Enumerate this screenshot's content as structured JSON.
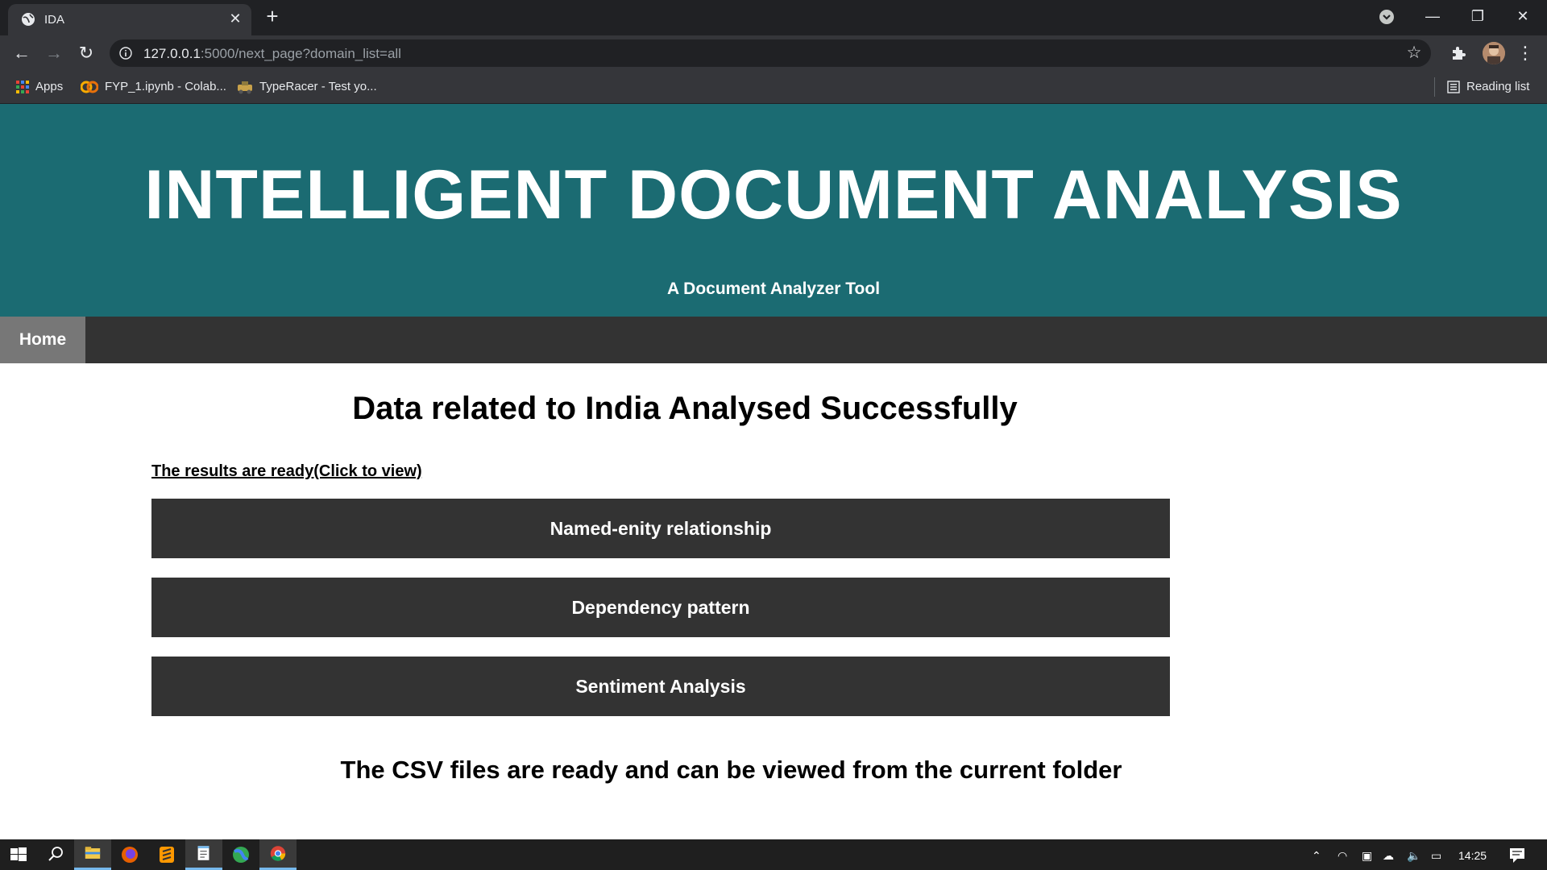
{
  "browser": {
    "tab": {
      "title": "IDA"
    },
    "address": {
      "host": "127.0.0.1",
      "path": ":5000/next_page?domain_list=all"
    },
    "bookmarks": [
      {
        "label": "Apps",
        "icon": "apps-grid-icon"
      },
      {
        "label": "FYP_1.ipynb - Colab...",
        "icon": "colab-icon"
      },
      {
        "label": "TypeRacer - Test yo...",
        "icon": "typeracer-icon"
      }
    ],
    "reading_list": {
      "label": "Reading list",
      "icon": "reading-list-icon"
    }
  },
  "header": {
    "title": "INTELLIGENT DOCUMENT ANALYSIS",
    "subtitle": "A Document Analyzer Tool"
  },
  "nav": {
    "home_label": "Home"
  },
  "main": {
    "heading": "Data related to India Analysed Successfully",
    "results_link": "The results are ready(Click to view)",
    "buttons": [
      {
        "label": "Named-enity relationship"
      },
      {
        "label": "Dependency pattern"
      },
      {
        "label": "Sentiment Analysis"
      }
    ],
    "csv_note": "The CSV files are ready and can be viewed from the current folder"
  },
  "taskbar": {
    "apps": [
      "windows-start-icon",
      "search-icon",
      "file-explorer-icon",
      "firefox-icon",
      "sublime-text-icon",
      "notepad-icon",
      "maps-icon",
      "chrome-icon"
    ],
    "clock": "14:25"
  },
  "colors": {
    "header_bg": "#1b6b72",
    "nav_bg": "#333333",
    "nav_active_bg": "#777777",
    "button_bg": "#333333",
    "chrome_dark": "#202124",
    "chrome_toolbar": "#35363a"
  }
}
